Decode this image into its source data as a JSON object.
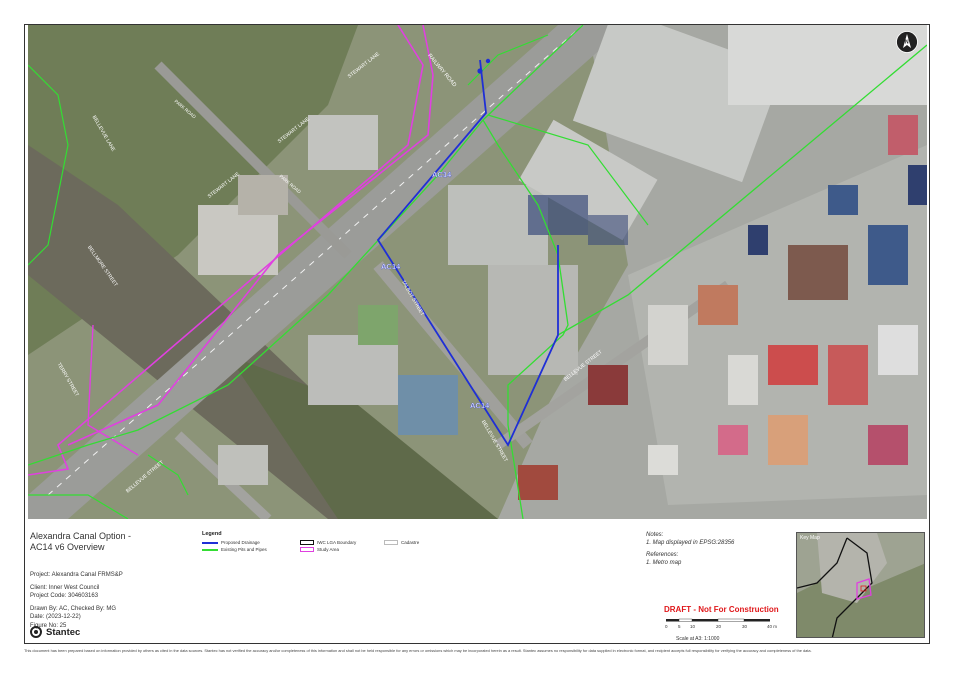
{
  "map": {
    "labels": {
      "railway_road": "RAILWAY ROAD",
      "stewart_lane_1": "STEWART LANE",
      "stewart_lane_2": "STEWART LANE",
      "stewart_lane_3": "STEWART LANE",
      "park_road_1": "PARK ROAD",
      "park_road_2": "PARK ROAD",
      "bellevue_lane": "BELLEVUE LANE",
      "bellmore_street": "BELLMORE STREET",
      "terry_street": "TERRY STREET",
      "bellevue_street_1": "BELLEVUE STREET",
      "bellevue_street_2": "BELLEVUE STREET",
      "bellevue_street_3": "BELLEVUE STREET",
      "talbot_street": "TALBOT STREET",
      "ac14_1": "AC14",
      "ac14_2": "AC14",
      "ac14_3": "AC14",
      "north": "N"
    },
    "colors": {
      "proposed_drainage": "#1f2fd6",
      "existing_pits_pipes": "#33dd33",
      "study_area": "#e040e0",
      "lga_boundary": "#111111"
    }
  },
  "title": {
    "line1": "Alexandra Canal Option -",
    "line2": "AC14 v6 Overview"
  },
  "info": {
    "project": "Project: Alexandra Canal FRMS&P",
    "client": "Client:  Inner West Council",
    "project_code": "Project Code:   304603163",
    "drawn_by": "Drawn By:    AC, Checked By: MG",
    "date": "Date:   (2023-12-22)",
    "figure_no": "Figure No:   25"
  },
  "logo": {
    "text": "Stantec"
  },
  "legend": {
    "title": "Legend",
    "items": {
      "proposed_drainage": "Proposed Drainage",
      "existing_pits": "Existing Pits and Pipes",
      "lga_boundary": "IWC LGA Boundary",
      "study_area": "Study Area",
      "cadastre": "Cadastre"
    }
  },
  "notes": {
    "heading": "Notes:",
    "line1": "1. Map displayed in EPSG:28356"
  },
  "references": {
    "heading": "References:",
    "line1": "1. Metro map"
  },
  "draft": "DRAFT - Not For Construction",
  "scale": {
    "ticks": [
      "0",
      "5",
      "10",
      "20",
      "30",
      "40 m"
    ],
    "text": "Scale at A3: 1:1000"
  },
  "keymap": {
    "title": "Key Map"
  },
  "disclaimer": "This document has been prepared based on information provided by others as cited in the data sources. Stantec has not verified the accuracy and/or completeness of this information and shall not be held responsible for any errors or omissions which may be incorporated herein as a result. Stantec assumes no responsibility for data supplied in electronic format, and recipient accepts full responsibility for verifying the accuracy and completeness of the data."
}
